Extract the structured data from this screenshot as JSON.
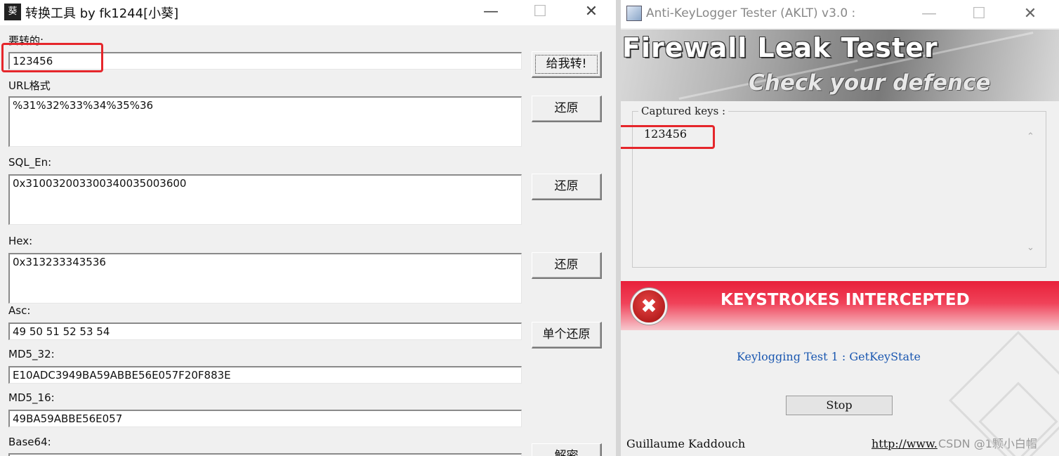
{
  "left_window": {
    "title": "转换工具 by fk1244[小葵]",
    "icon_glyph": "葵",
    "controls": {
      "minimize": "—",
      "maximize": "☐",
      "close": "✕"
    },
    "fields": {
      "input": {
        "label": "要转的:",
        "value": "123456",
        "button": "给我转!"
      },
      "url": {
        "label": "URL格式",
        "value": "%31%32%33%34%35%36",
        "button": "还原"
      },
      "sql": {
        "label": "SQL_En:",
        "value": "0x310032003300340035003600",
        "button": "还原"
      },
      "hex": {
        "label": "Hex:",
        "value": "0x313233343536",
        "button": "还原"
      },
      "asc": {
        "label": "Asc:",
        "value": "49 50 51 52 53 54",
        "button": "单个还原"
      },
      "md5_32": {
        "label": "MD5_32:",
        "value": "E10ADC3949BA59ABBE56E057F20F883E"
      },
      "md5_16": {
        "label": "MD5_16:",
        "value": "49BA59ABBE56E057"
      },
      "base64": {
        "label": "Base64:",
        "value": "",
        "button": "解密"
      }
    }
  },
  "right_window": {
    "title": "Anti-KeyLogger Tester (AKLT) v3.0 :",
    "controls": {
      "minimize": "—",
      "maximize": "☐",
      "close": "✕"
    },
    "banner": {
      "title": "Firewall Leak Tester",
      "subtitle": "Check your defence"
    },
    "captured": {
      "legend": "Captured keys :",
      "value": "123456"
    },
    "alert": {
      "text": "KEYSTROKES INTERCEPTED",
      "icon": "✖"
    },
    "test_line": "Keylogging Test 1 : GetKeyState",
    "stop_button": "Stop",
    "author": "Guillaume Kaddouch",
    "url": "http://www.",
    "watermark": "CSDN @1颗小白帽"
  },
  "colors": {
    "highlight_box": "#e5262b",
    "alert_red": "#e8203a",
    "link_blue": "#1a57b0"
  }
}
